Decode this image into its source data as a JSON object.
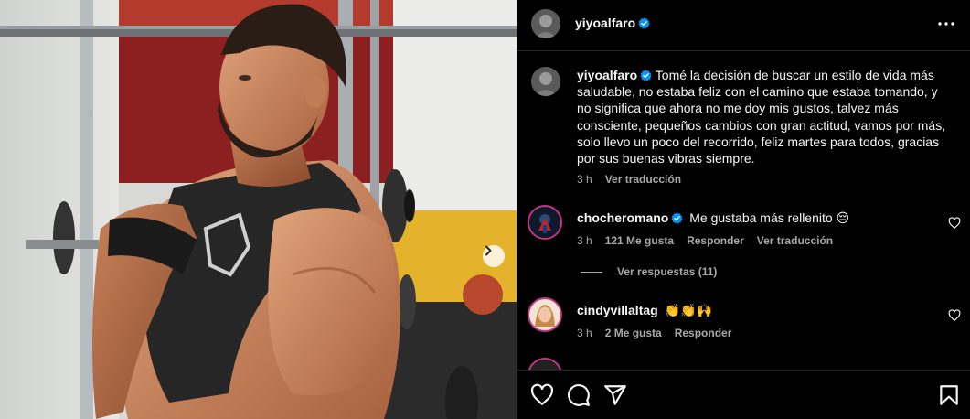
{
  "post": {
    "username": "yiyoalfaro",
    "caption": "Tomé la decisión de buscar un estilo de vida más saludable, no estaba feliz con el camino que estaba tomando, y no significa que ahora no me doy mis gustos, talvez más consciente, pequeños cambios con gran actitud, vamos por más, solo llevo un poco del recorrido, feliz martes para todos, gracias por sus buenas vibras siempre.",
    "caption_time": "3 h",
    "caption_translate": "Ver traducción"
  },
  "comments": [
    {
      "username": "chocheromano",
      "text": "Me gustaba más rellenito 😔",
      "time": "3 h",
      "likes": "121 Me gusta",
      "reply": "Responder",
      "translate": "Ver traducción",
      "view_replies": "Ver respuestas (11)"
    },
    {
      "username": "cindyvillaltag",
      "text": "👏👏🙌",
      "time": "3 h",
      "likes": "2 Me gusta",
      "reply": "Responder"
    }
  ],
  "icons": {
    "verified": "verified-badge-icon",
    "more": "more-options-icon",
    "like": "heart-icon",
    "comment": "comment-icon",
    "share": "share-icon",
    "save": "bookmark-icon",
    "next": "chevron-right-icon"
  },
  "colors": {
    "background": "#000000",
    "text": "#f5f5f5",
    "secondary_text": "#a8a8a8",
    "verified": "#0095f6",
    "divider": "#262626"
  }
}
